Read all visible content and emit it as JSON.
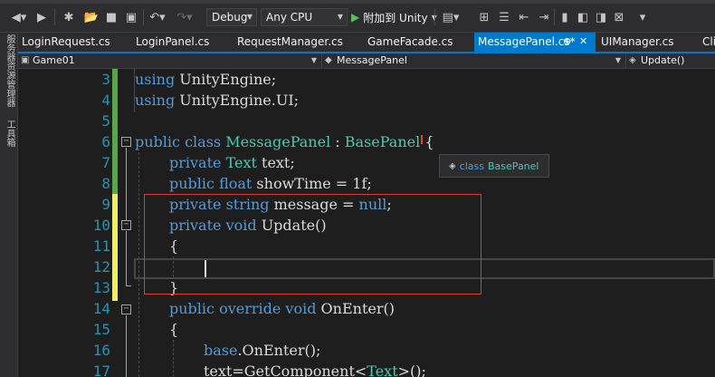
{
  "toolbar": {
    "configuration": "Debug",
    "platform": "Any CPU",
    "run_label": "附加到 Unity",
    "colors": {
      "background": "#2d2d30",
      "run_icon": "#55c25c"
    }
  },
  "left_strip": {
    "server_explorer": "服务器资源管理器",
    "toolbox": "工具箱"
  },
  "tabs": [
    {
      "label": "LoginRequest.cs",
      "active": false
    },
    {
      "label": "LoginPanel.cs",
      "active": false
    },
    {
      "label": "RequestManager.cs",
      "active": false
    },
    {
      "label": "GameFacade.cs",
      "active": false
    },
    {
      "label": "MessagePanel.cs*",
      "active": true
    },
    {
      "label": "UIManager.cs",
      "active": false
    },
    {
      "label": "Cli",
      "active": false
    }
  ],
  "navbar": {
    "project": "Game01",
    "class": "MessagePanel",
    "member": "Update()"
  },
  "editor": {
    "line_numbers": [
      "3",
      "4",
      "5",
      "6",
      "7",
      "8",
      "9",
      "10",
      "11",
      "12",
      "13",
      "14",
      "15",
      "16",
      "17"
    ],
    "lines": {
      "l3_kw": "using",
      "l3_rest": " UnityEngine;",
      "l4_kw": "using",
      "l4_rest": " UnityEngine.UI;",
      "l6_kw1": "public",
      "l6_kw2": " class",
      "l6_ty": " MessagePanel",
      "l6_pl": " :",
      "l6_ty2": " BasePanel",
      "l6_br": " {",
      "l7_kw": "private",
      "l7_ty": " Text",
      "l7_rest": " text;",
      "l8_kw": "public",
      "l8_kw2": " float",
      "l8_rest": " showTime = 1f;",
      "l9_kw": "private",
      "l9_kw2": " string",
      "l9_rest": " message = ",
      "l9_kw3": "null",
      "l9_end": ";",
      "l10_kw": "private",
      "l10_kw2": " void",
      "l10_rest": " Update()",
      "l11_rest": "{",
      "l13_rest": "}",
      "l14_kw": "public",
      "l14_kw2": " override",
      "l14_kw3": " void",
      "l14_rest": " OnEnter()",
      "l15_rest": "{",
      "l16_kw": "base",
      "l16_rest": ".OnEnter();",
      "l17_rest": "text=GetComponent<",
      "l17_ty": "Text",
      "l17_end": ">();"
    },
    "colors": {
      "keyword": "#569cd6",
      "type": "#4ec9b0",
      "line_number": "#2b91af",
      "highlight_box": "#e03a3a"
    }
  },
  "tooltip": {
    "keyword": "class",
    "type_name": "BasePanel"
  }
}
